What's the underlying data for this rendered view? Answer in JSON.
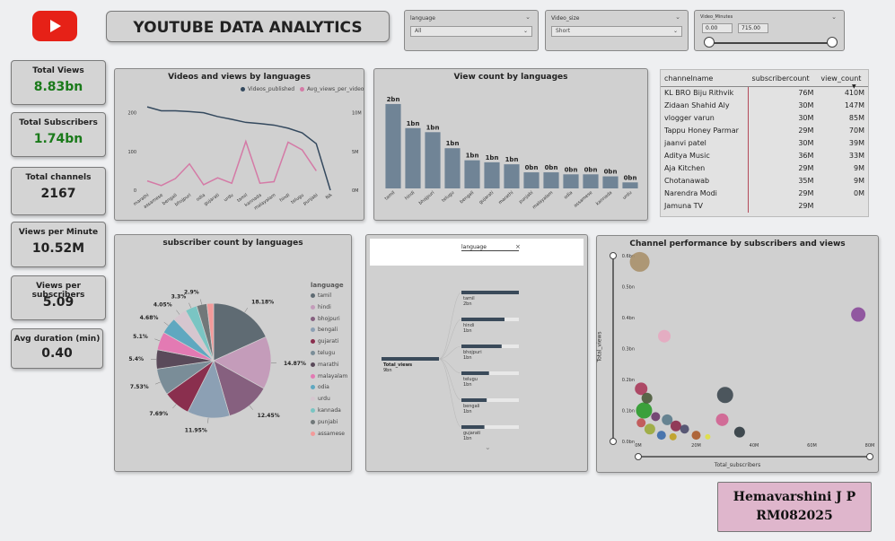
{
  "header": {
    "title": "YOUTUBE DATA ANALYTICS",
    "logo": "youtube-logo"
  },
  "slicers": {
    "language": {
      "label": "language",
      "value": "All"
    },
    "video_size": {
      "label": "Video_size",
      "value": "Short"
    },
    "video_minutes": {
      "label": "Video_Minutes",
      "min": "0.00",
      "max": "715.00"
    }
  },
  "kpis": [
    {
      "title": "Total Views",
      "value": "8.83bn"
    },
    {
      "title": "Total Subscribers",
      "value": "1.74bn"
    },
    {
      "title": "Total channels",
      "value": "2167"
    },
    {
      "title": "Views per Minute",
      "value": "10.52M"
    },
    {
      "title": "Views per subscribers",
      "value": "5.09"
    },
    {
      "title": "Avg duration (min)",
      "value": "0.40"
    }
  ],
  "colors": {
    "green": "#1a7a1a",
    "line1": "#34495e",
    "line2": "#d47aa6",
    "bar": "#708496"
  },
  "charts": {
    "videos_views": {
      "title": "Videos and views by languages",
      "legend": [
        "Videos_published",
        "Avg_views_per_video"
      ],
      "left_ticks": [
        "200",
        "100",
        "0"
      ],
      "right_ticks": [
        "10M",
        "5M",
        "0M"
      ]
    },
    "view_count": {
      "title": "View count by languages"
    },
    "subscriber_pie": {
      "title": "subscriber count by languages",
      "legend_title": "language"
    },
    "decomp": {
      "title_field": "language",
      "root_label": "Total_views",
      "root_value": "9bn",
      "nodes": [
        {
          "label": "tamil",
          "value": "2bn"
        },
        {
          "label": "hindi",
          "value": "1bn"
        },
        {
          "label": "bhojpuri",
          "value": "1bn"
        },
        {
          "label": "telugu",
          "value": "1bn"
        },
        {
          "label": "bengali",
          "value": "1bn"
        },
        {
          "label": "gujarati",
          "value": "1bn"
        }
      ]
    },
    "scatter": {
      "title": "Channel performance by subscribers and views",
      "xlabel": "Total_subscribers",
      "ylabel": "Total_views",
      "x_ticks": [
        "0M",
        "20M",
        "40M",
        "60M",
        "80M"
      ],
      "y_ticks": [
        "0.6bn",
        "0.5bn",
        "0.4bn",
        "0.3bn",
        "0.2bn",
        "0.1bn",
        "0.0bn"
      ]
    }
  },
  "table": {
    "headers": [
      "channelname",
      "subscribercount",
      "view_count"
    ],
    "rows": [
      [
        "KL BRO Biju Rithvik",
        "76M",
        "410M"
      ],
      [
        "Zidaan Shahid Aly",
        "30M",
        "147M"
      ],
      [
        "vlogger varun",
        "30M",
        "85M"
      ],
      [
        "Tappu Honey Parmar",
        "29M",
        "70M"
      ],
      [
        "jaanvi patel",
        "30M",
        "39M"
      ],
      [
        "Aditya Music",
        "36M",
        "33M"
      ],
      [
        "Aja Kitchen",
        "29M",
        "9M"
      ],
      [
        "Chotanawab",
        "35M",
        "9M"
      ],
      [
        "Narendra Modi",
        "29M",
        "0M"
      ],
      [
        "Jamuna TV",
        "29M",
        ""
      ]
    ]
  },
  "author": {
    "name": "Hemavarshini J P",
    "id": "RM082025"
  },
  "chart_data": [
    {
      "type": "line",
      "title": "Videos and views by languages",
      "categories": [
        "marathi",
        "assamese",
        "bengali",
        "bhojpuri",
        "odia",
        "gujarati",
        "urdu",
        "tamil",
        "kannada",
        "malayalam",
        "hindi",
        "telugu",
        "punjabi",
        "NA"
      ],
      "series": [
        {
          "name": "Videos_published",
          "axis": "left",
          "values": [
            215,
            205,
            205,
            203,
            200,
            190,
            183,
            175,
            172,
            168,
            160,
            148,
            120,
            0
          ]
        },
        {
          "name": "Avg_views_per_video",
          "axis": "right",
          "values": [
            1.2,
            0.6,
            1.5,
            3.4,
            0.7,
            1.6,
            0.9,
            6.3,
            0.9,
            1.1,
            6.2,
            5.2,
            2.5,
            null
          ]
        }
      ],
      "ylim_left": [
        0,
        220
      ],
      "ylim_right": [
        0,
        11
      ]
    },
    {
      "type": "bar",
      "title": "View count by languages",
      "categories": [
        "tamil",
        "hindi",
        "bhojpuri",
        "telugu",
        "bengali",
        "gujarati",
        "marathi",
        "punjabi",
        "malayalam",
        "odia",
        "assamese",
        "kannada",
        "urdu"
      ],
      "values": [
        2.1,
        1.5,
        1.4,
        1.0,
        0.7,
        0.65,
        0.6,
        0.4,
        0.4,
        0.35,
        0.35,
        0.3,
        0.15
      ],
      "labels": [
        "2bn",
        "1bn",
        "1bn",
        "1bn",
        "1bn",
        "1bn",
        "1bn",
        "0bn",
        "0bn",
        "0bn",
        "0bn",
        "0bn",
        "0bn"
      ]
    },
    {
      "type": "pie",
      "title": "subscriber count by languages",
      "slices": [
        {
          "label": "tamil",
          "value": 18.18,
          "color": "#5f6b73"
        },
        {
          "label": "hindi",
          "value": 14.87,
          "color": "#c49cba"
        },
        {
          "label": "bhojpuri",
          "value": 12.45,
          "color": "#86607f"
        },
        {
          "label": "bengali",
          "value": 11.95,
          "color": "#8ca0b4"
        },
        {
          "label": "gujarati",
          "value": 7.69,
          "color": "#8a2f4e"
        },
        {
          "label": "telugu",
          "value": 7.53,
          "color": "#7a8d98"
        },
        {
          "label": "marathi",
          "value": 5.4,
          "color": "#5a4a5a"
        },
        {
          "label": "malayalam",
          "value": 5.1,
          "color": "#e37ab3"
        },
        {
          "label": "odia",
          "value": 4.68,
          "color": "#5fa8c0"
        },
        {
          "label": "urdu",
          "value": 4.05,
          "color": "#d6c6cf"
        },
        {
          "label": "kannada",
          "value": 3.3,
          "color": "#7ac5c3"
        },
        {
          "label": "punjabi",
          "value": 2.9,
          "color": "#717879"
        },
        {
          "label": "assamese",
          "value": 1.9,
          "color": "#f39a9a"
        }
      ]
    },
    {
      "type": "scatter",
      "title": "Channel performance by subscribers and views",
      "xlabel": "Total_subscribers",
      "ylabel": "Total_views",
      "xlim": [
        0,
        80
      ],
      "ylim": [
        0,
        0.6
      ],
      "points": [
        {
          "x": 0.5,
          "y": 0.58,
          "r": 11,
          "color": "#a8906a"
        },
        {
          "x": 76,
          "y": 0.41,
          "r": 8,
          "color": "#8a4a9a"
        },
        {
          "x": 9,
          "y": 0.34,
          "r": 7,
          "color": "#e6a8c0"
        },
        {
          "x": 30,
          "y": 0.15,
          "r": 9,
          "color": "#3d4850"
        },
        {
          "x": 29,
          "y": 0.07,
          "r": 7,
          "color": "#d06090"
        },
        {
          "x": 35,
          "y": 0.03,
          "r": 6,
          "color": "#2f3a40"
        },
        {
          "x": 1,
          "y": 0.17,
          "r": 7,
          "color": "#a83a5a"
        },
        {
          "x": 2,
          "y": 0.1,
          "r": 9,
          "color": "#2a9a2a"
        },
        {
          "x": 3,
          "y": 0.14,
          "r": 6,
          "color": "#4a5a3a"
        },
        {
          "x": 6,
          "y": 0.08,
          "r": 5,
          "color": "#6a3a6a"
        },
        {
          "x": 10,
          "y": 0.07,
          "r": 6,
          "color": "#5a7a8a"
        },
        {
          "x": 13,
          "y": 0.05,
          "r": 6,
          "color": "#8a2a4a"
        },
        {
          "x": 16,
          "y": 0.04,
          "r": 5,
          "color": "#4a4a6a"
        },
        {
          "x": 20,
          "y": 0.02,
          "r": 5,
          "color": "#aa5a2a"
        },
        {
          "x": 4,
          "y": 0.04,
          "r": 6,
          "color": "#9aaa3a"
        },
        {
          "x": 8,
          "y": 0.02,
          "r": 5,
          "color": "#3a6aaa"
        },
        {
          "x": 1,
          "y": 0.06,
          "r": 5,
          "color": "#c05050"
        },
        {
          "x": 12,
          "y": 0.015,
          "r": 4,
          "color": "#c0a020"
        },
        {
          "x": 24,
          "y": 0.015,
          "r": 3,
          "color": "#e0e040"
        }
      ]
    }
  ]
}
